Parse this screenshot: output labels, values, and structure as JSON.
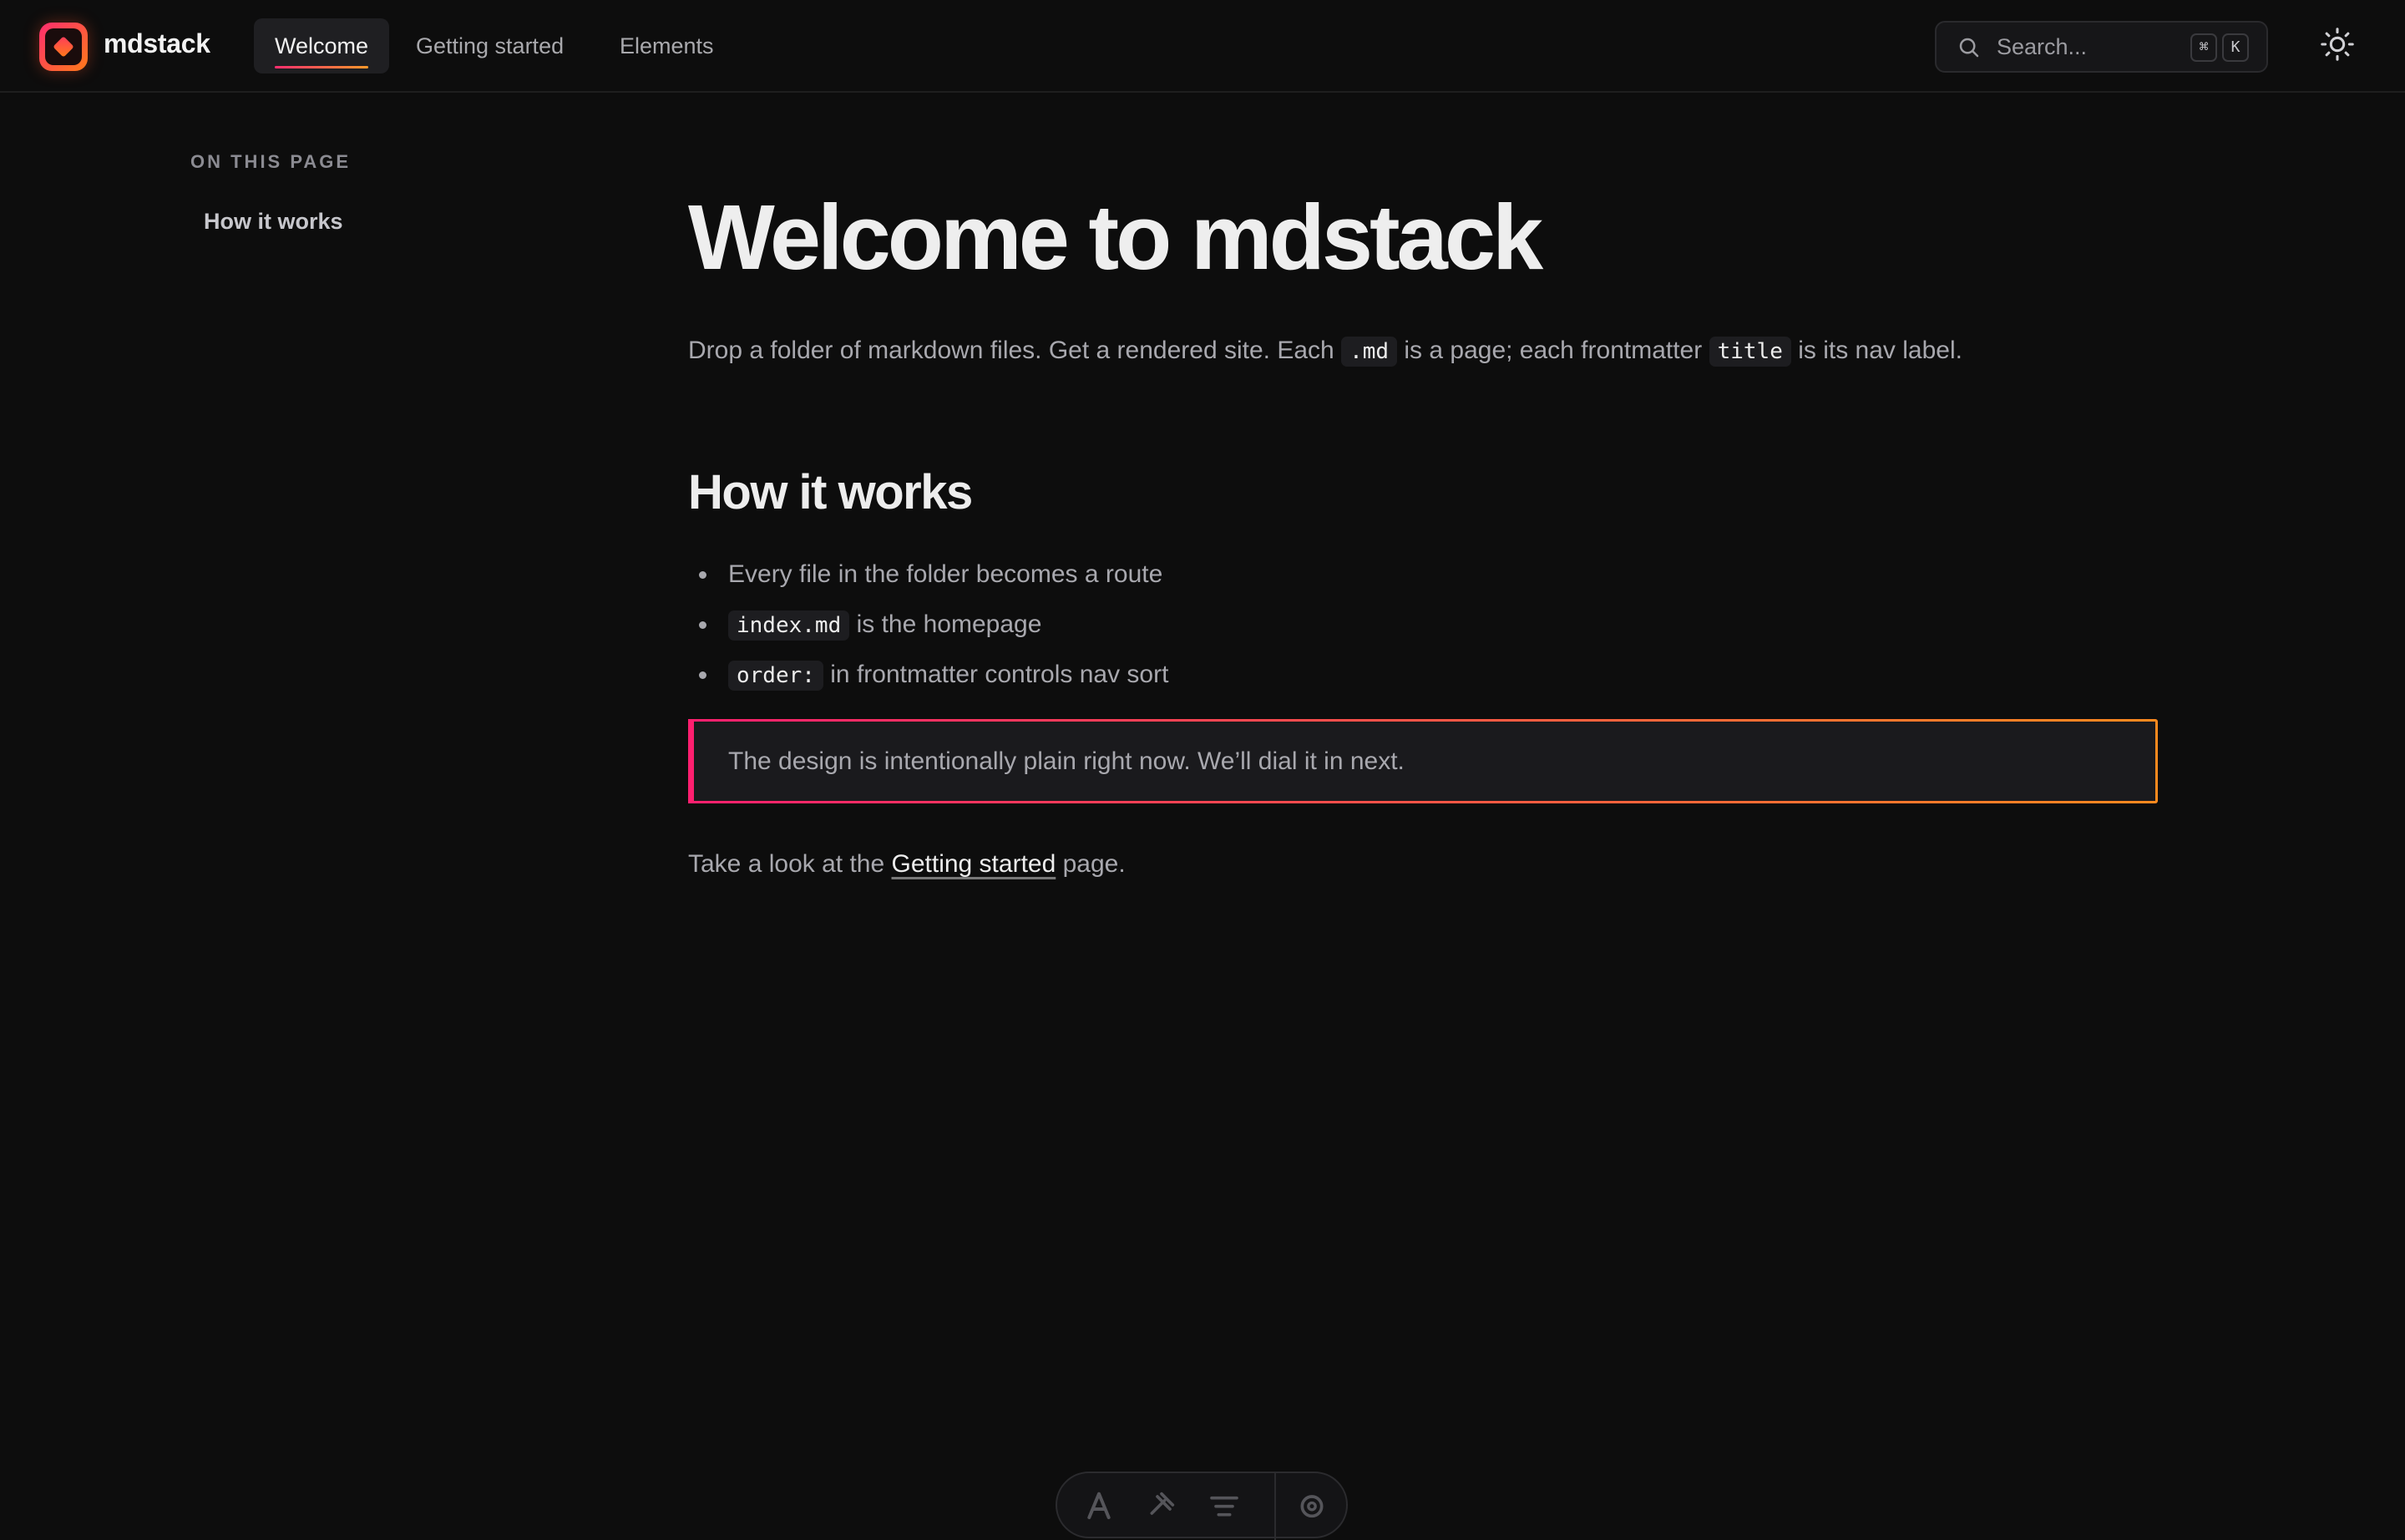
{
  "header": {
    "brand": "mdstack",
    "tabs": [
      {
        "label": "Welcome",
        "active": true
      },
      {
        "label": "Getting started",
        "active": false
      },
      {
        "label": "Elements",
        "active": false
      }
    ],
    "search": {
      "placeholder": "Search...",
      "shortcut_keys": [
        "⌘",
        "K"
      ]
    },
    "theme_toggle_icon": "sun-icon"
  },
  "toc": {
    "heading": "ON THIS PAGE",
    "items": [
      "How it works"
    ]
  },
  "main": {
    "title": "Welcome to mdstack",
    "lead": {
      "part1": "Drop a folder of markdown files. Get a rendered site. Each ",
      "code1": ".md",
      "part2": " is a page; each frontmatter ",
      "code2": "title",
      "part3": " is its nav label."
    },
    "section_heading": "How it works",
    "bullets": [
      {
        "code": "",
        "text": "Every file in the folder becomes a route"
      },
      {
        "code": "index.md",
        "text": " is the homepage"
      },
      {
        "code": "order:",
        "text": " in frontmatter controls nav sort"
      }
    ],
    "callout": "The design is intentionally plain right now. We’ll dial it in next.",
    "footer": {
      "before": "Take a look at the ",
      "link": "Getting started",
      "after": " page."
    }
  },
  "colors": {
    "background": "#0d0d0d",
    "accent_start": "#ff1f6f",
    "accent_end": "#ff8a1e"
  }
}
